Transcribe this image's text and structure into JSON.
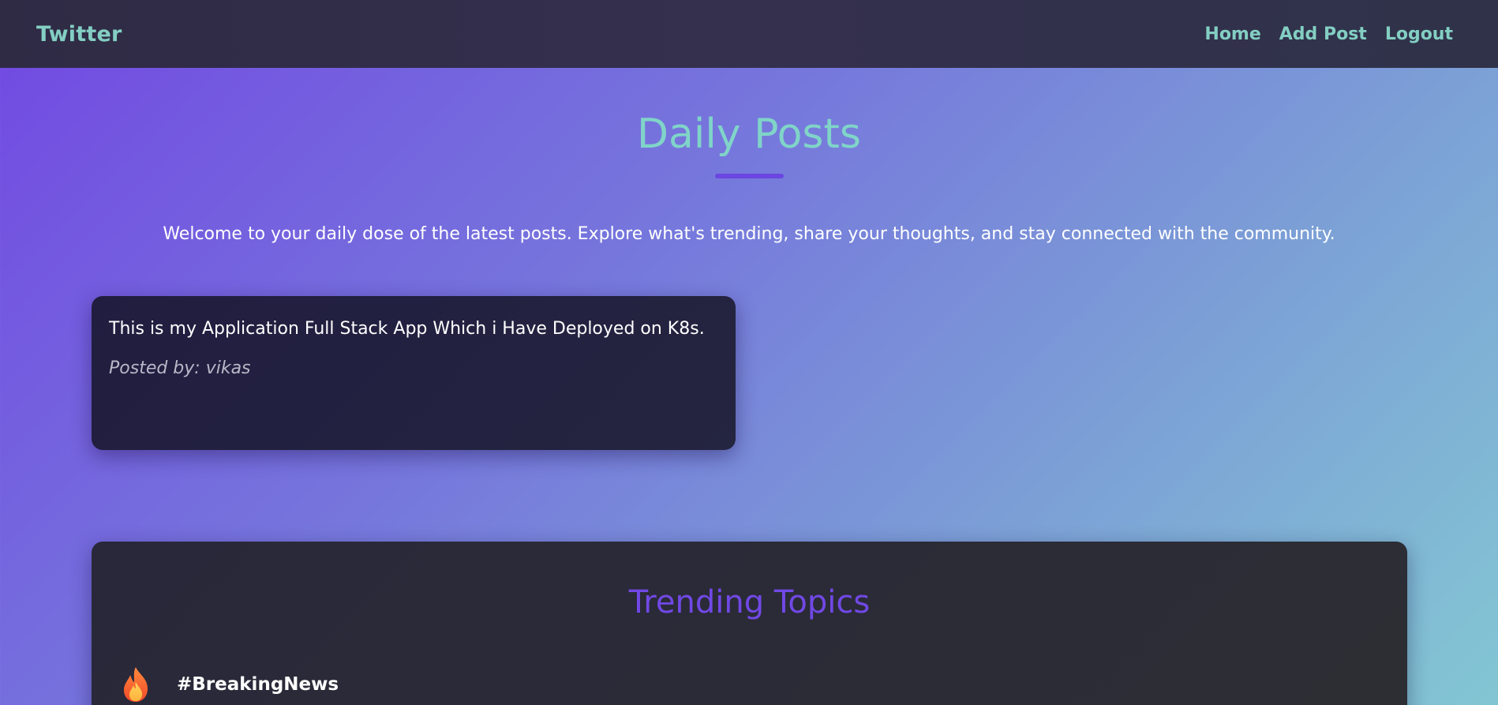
{
  "navbar": {
    "brand": "Twitter",
    "links": [
      {
        "label": "Home"
      },
      {
        "label": "Add Post"
      },
      {
        "label": "Logout"
      }
    ]
  },
  "main": {
    "title": "Daily Posts",
    "welcome": "Welcome to your daily dose of the latest posts. Explore what's trending, share your thoughts, and stay connected with the community."
  },
  "posts": [
    {
      "text": "This is my Application Full Stack App Which i Have Deployed on K8s.",
      "author": "Posted by: vikas"
    }
  ],
  "trending": {
    "title": "Trending Topics",
    "topics": [
      {
        "icon": "fire-icon",
        "label": "#BreakingNews"
      }
    ]
  },
  "colors": {
    "accent": "#83cfc3",
    "purple": "#7148e6",
    "nav_bg": "#302c47",
    "card_bg": "#221f40"
  }
}
